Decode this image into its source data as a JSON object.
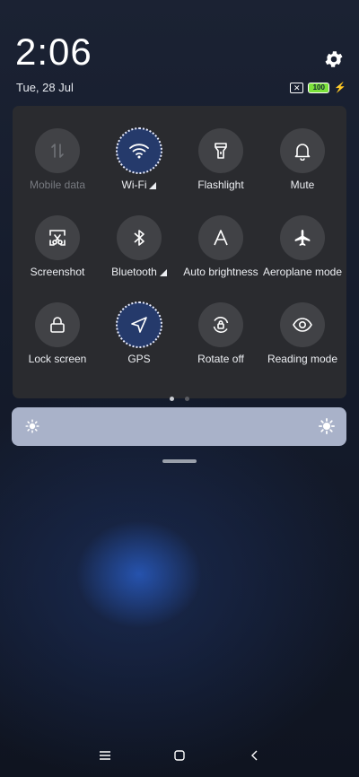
{
  "status": {
    "time": "2:06",
    "date": "Tue, 28 Jul",
    "battery": "100",
    "sim_glyph": "✕"
  },
  "tiles": [
    {
      "label": "Mobile data",
      "icon": "mobile-data-icon",
      "active": false,
      "dim": true
    },
    {
      "label": "Wi-Fi",
      "icon": "wifi-icon",
      "active": true,
      "signal": true
    },
    {
      "label": "Flashlight",
      "icon": "flashlight-icon",
      "active": false
    },
    {
      "label": "Mute",
      "icon": "bell-icon",
      "active": false
    },
    {
      "label": "Screenshot",
      "icon": "screenshot-icon",
      "active": false
    },
    {
      "label": "Bluetooth",
      "icon": "bluetooth-icon",
      "active": false,
      "signal": true
    },
    {
      "label": "Auto brightness",
      "icon": "auto-brightness-icon",
      "active": false
    },
    {
      "label": "Aeroplane mode",
      "icon": "airplane-icon",
      "active": false
    },
    {
      "label": "Lock screen",
      "icon": "lock-icon",
      "active": false
    },
    {
      "label": "GPS",
      "icon": "location-arrow-icon",
      "active": true
    },
    {
      "label": "Rotate off",
      "icon": "rotate-lock-icon",
      "active": false
    },
    {
      "label": "Reading mode",
      "icon": "eye-icon",
      "active": false
    }
  ],
  "pager": {
    "pages": 2,
    "current": 1
  },
  "brightness": {
    "level": 0.0
  },
  "colors": {
    "panel": "#2a2b2f",
    "tile": "#414246",
    "tile_active": "#253a6b",
    "slider": "#a9b2c9",
    "battery": "#7be23b"
  },
  "nav": {
    "items": [
      "menu-icon",
      "home-icon",
      "back-icon"
    ]
  }
}
